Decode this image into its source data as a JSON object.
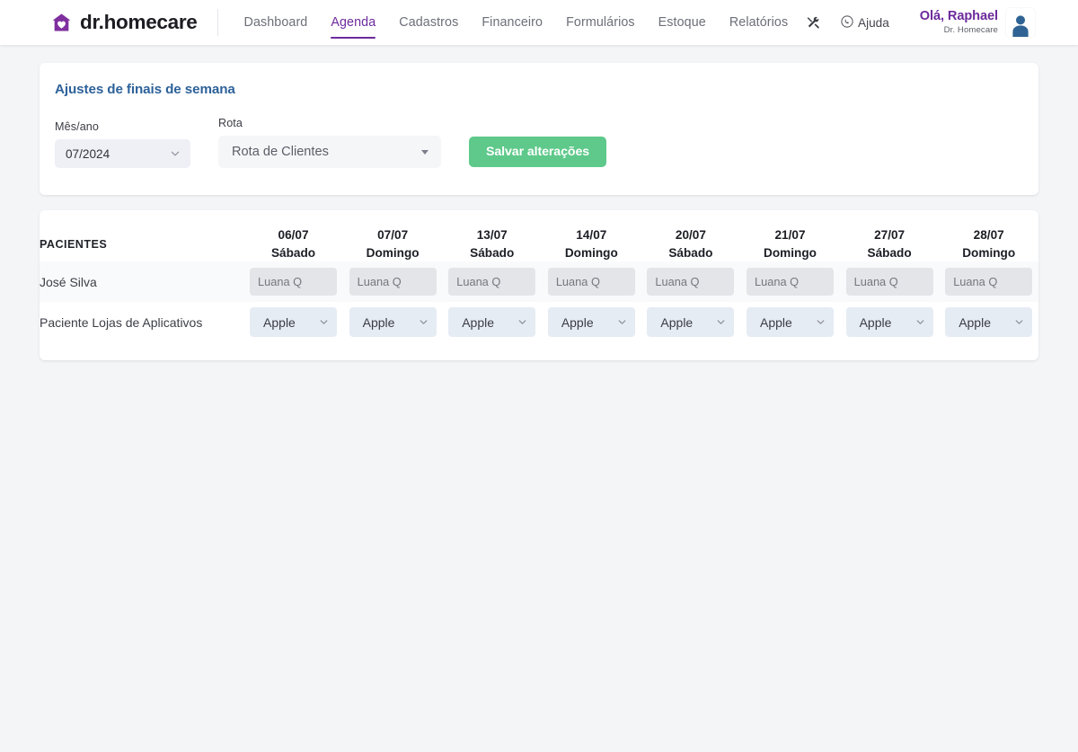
{
  "header": {
    "brand": "dr.homecare",
    "brand_icon": "house-heart-logo",
    "nav": [
      {
        "label": "Dashboard",
        "active": false
      },
      {
        "label": "Agenda",
        "active": true
      },
      {
        "label": "Cadastros",
        "active": false
      },
      {
        "label": "Financeiro",
        "active": false
      },
      {
        "label": "Formulários",
        "active": false
      },
      {
        "label": "Estoque",
        "active": false
      },
      {
        "label": "Relatórios",
        "active": false
      }
    ],
    "tools_icon": "tools-icon",
    "help_label": "Ajuda",
    "help_icon": "whatsapp-icon",
    "user_greeting": "Olá, Raphael",
    "user_org": "Dr. Homecare",
    "avatar_icon": "user-avatar-icon",
    "accent_color": "#6c2a9c"
  },
  "filters": {
    "title": "Ajustes de finais de semana",
    "month_label": "Mês/ano",
    "month_value": "07/2024",
    "route_label": "Rota",
    "route_value": "Rota de Clientes",
    "save_label": "Salvar alterações",
    "save_color": "#5ec98a"
  },
  "table": {
    "patients_header": "PACIENTES",
    "columns": [
      {
        "date": "06/07",
        "weekday": "Sábado"
      },
      {
        "date": "07/07",
        "weekday": "Domingo"
      },
      {
        "date": "13/07",
        "weekday": "Sábado"
      },
      {
        "date": "14/07",
        "weekday": "Domingo"
      },
      {
        "date": "20/07",
        "weekday": "Sábado"
      },
      {
        "date": "21/07",
        "weekday": "Domingo"
      },
      {
        "date": "27/07",
        "weekday": "Sábado"
      },
      {
        "date": "28/07",
        "weekday": "Domingo"
      }
    ],
    "rows": [
      {
        "name": "José Silva",
        "control": "text",
        "cells": [
          {
            "placeholder": "Luana Q",
            "value": ""
          },
          {
            "placeholder": "Luana Q",
            "value": ""
          },
          {
            "placeholder": "Luana Q",
            "value": ""
          },
          {
            "placeholder": "Luana Q",
            "value": ""
          },
          {
            "placeholder": "Luana Q",
            "value": ""
          },
          {
            "placeholder": "Luana Q",
            "value": ""
          },
          {
            "placeholder": "Luana Q",
            "value": ""
          },
          {
            "placeholder": "Luana Q",
            "value": ""
          }
        ]
      },
      {
        "name": "Paciente Lojas de Aplicativos",
        "control": "select",
        "cells": [
          {
            "value": "Apple"
          },
          {
            "value": "Apple"
          },
          {
            "value": "Apple"
          },
          {
            "value": "Apple"
          },
          {
            "value": "Apple"
          },
          {
            "value": "Apple"
          },
          {
            "value": "Apple"
          },
          {
            "value": "Apple"
          }
        ]
      }
    ]
  }
}
